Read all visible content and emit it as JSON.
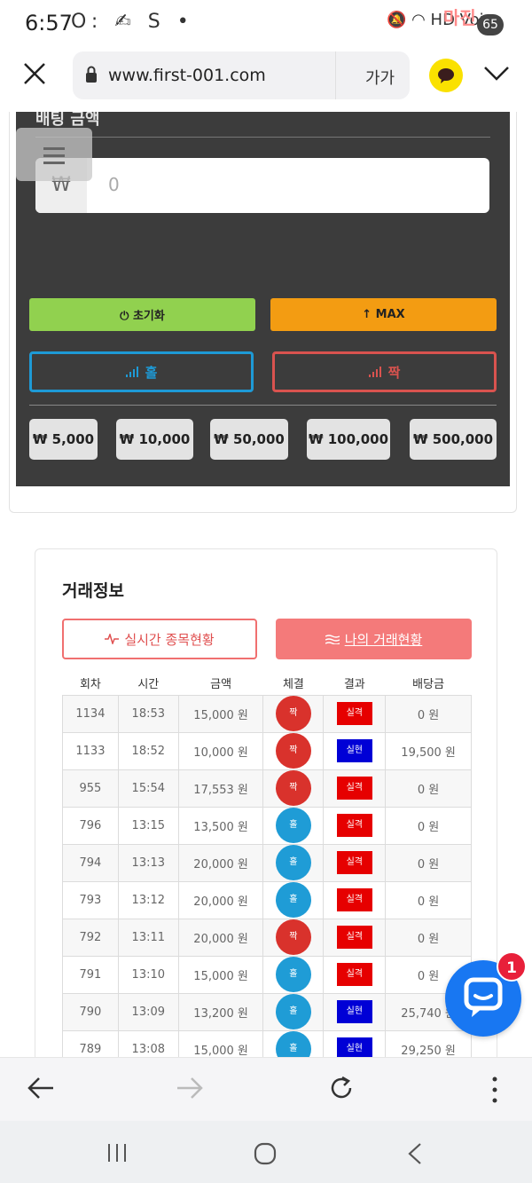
{
  "status_bar": {
    "time": "6:57",
    "left_icons": "O: ✍ S •",
    "right_icons": "🔕 ◠ HD Voice",
    "watermark": "마진",
    "battery": "65"
  },
  "browser": {
    "url": "www.first-001.com",
    "font_size_label": "가가"
  },
  "bet_panel": {
    "title": "배팅 금액",
    "currency_symbol": "₩",
    "amount_value": "0",
    "reset_label": "⏻ 초기화",
    "max_label": "↑ MAX",
    "odd_label": "홀",
    "even_label": "짝",
    "chips": [
      "₩ 5,000",
      "₩ 10,000",
      "₩ 50,000",
      "₩ 100,000",
      "₩ 500,000"
    ]
  },
  "trade_card": {
    "title": "거래정보",
    "tab_live": "실시간 종목현황",
    "tab_mine": "나의 거래현황",
    "columns": [
      "회차",
      "시간",
      "금액",
      "체결",
      "결과",
      "배당금"
    ],
    "rows": [
      {
        "round": "1134",
        "time": "18:53",
        "amount": "15,000 원",
        "fill": "짝",
        "result": "실격",
        "payout": "0 원"
      },
      {
        "round": "1133",
        "time": "18:52",
        "amount": "10,000 원",
        "fill": "짝",
        "result": "실현",
        "payout": "19,500 원"
      },
      {
        "round": "955",
        "time": "15:54",
        "amount": "17,553 원",
        "fill": "짝",
        "result": "실격",
        "payout": "0 원"
      },
      {
        "round": "796",
        "time": "13:15",
        "amount": "13,500 원",
        "fill": "홀",
        "result": "실격",
        "payout": "0 원"
      },
      {
        "round": "794",
        "time": "13:13",
        "amount": "20,000 원",
        "fill": "홀",
        "result": "실격",
        "payout": "0 원"
      },
      {
        "round": "793",
        "time": "13:12",
        "amount": "20,000 원",
        "fill": "홀",
        "result": "실격",
        "payout": "0 원"
      },
      {
        "round": "792",
        "time": "13:11",
        "amount": "20,000 원",
        "fill": "짝",
        "result": "실격",
        "payout": "0 원"
      },
      {
        "round": "791",
        "time": "13:10",
        "amount": "15,000 원",
        "fill": "홀",
        "result": "실격",
        "payout": "0 원"
      },
      {
        "round": "790",
        "time": "13:09",
        "amount": "13,200 원",
        "fill": "홀",
        "result": "실현",
        "payout": "25,740 원"
      },
      {
        "round": "789",
        "time": "13:08",
        "amount": "15,000 원",
        "fill": "홀",
        "result": "실현",
        "payout": "29,250 원"
      }
    ]
  },
  "chat_badge": "1",
  "colors": {
    "odd_blue": "#1f9cd6",
    "even_red": "#d9322c",
    "loss_red": "#e60000",
    "win_blue": "#0000d6",
    "reset_green": "#91d14f",
    "max_orange": "#f39c12",
    "tab_pink": "#f47a7a"
  }
}
